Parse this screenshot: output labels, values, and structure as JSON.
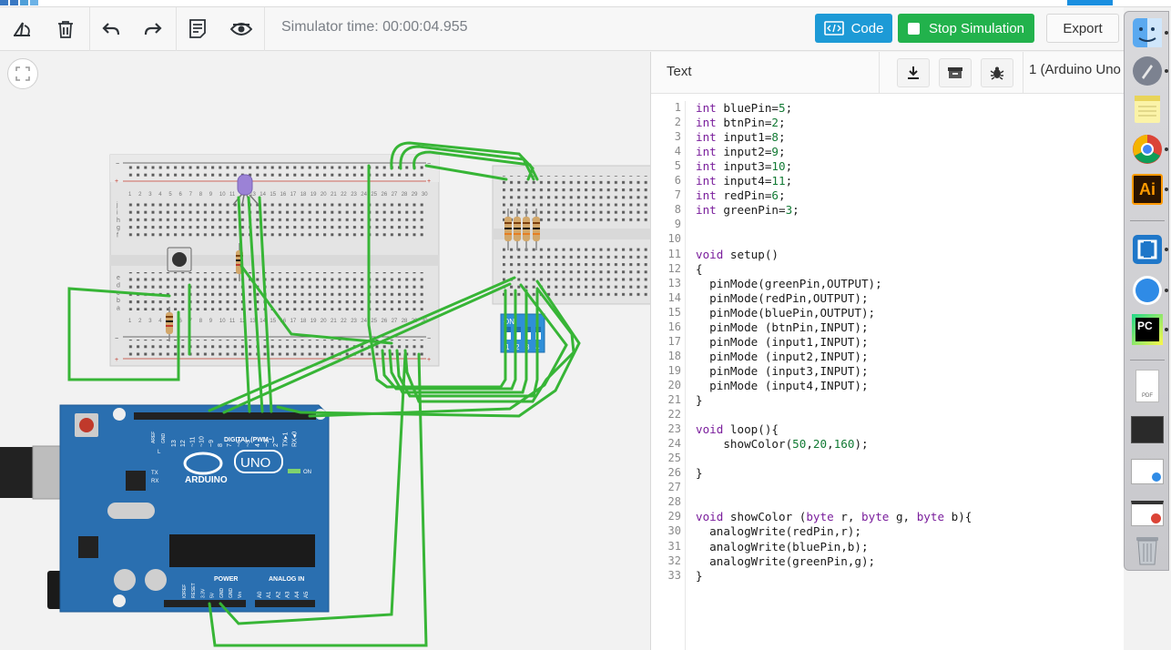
{
  "toolbar": {
    "rotate_icon": "rotate-icon",
    "delete_icon": "trash-icon",
    "undo_icon": "undo-icon",
    "redo_icon": "redo-icon",
    "notes_icon": "notes-icon",
    "visibility_icon": "eye-icon",
    "sim_time": "Simulator time: 00:00:04.955",
    "code_label": "Code",
    "stop_label": "Stop Simulation",
    "export_label": "Export",
    "colors": {
      "code_btn": "#1d9ad6",
      "stop_btn": "#22b24c"
    }
  },
  "code_panel": {
    "mode": "Text",
    "device": "1 (Arduino Uno",
    "download_icon": "download-icon",
    "library_icon": "library-icon",
    "debug_icon": "bug-icon",
    "lines": [
      {
        "n": "1",
        "code": "int bluePin=5;"
      },
      {
        "n": "2",
        "code": "int btnPin=2;"
      },
      {
        "n": "3",
        "code": "int input1=8;"
      },
      {
        "n": "4",
        "code": "int input2=9;"
      },
      {
        "n": "5",
        "code": "int input3=10;"
      },
      {
        "n": "6",
        "code": "int input4=11;"
      },
      {
        "n": "7",
        "code": "int redPin=6;"
      },
      {
        "n": "8",
        "code": "int greenPin=3;"
      },
      {
        "n": "9",
        "code": ""
      },
      {
        "n": "10",
        "code": ""
      },
      {
        "n": "11",
        "code": "void setup()"
      },
      {
        "n": "12",
        "code": "{"
      },
      {
        "n": "13",
        "code": "  pinMode(greenPin,OUTPUT);"
      },
      {
        "n": "14",
        "code": "  pinMode(redPin,OUTPUT);"
      },
      {
        "n": "15",
        "code": "  pinMode(bluePin,OUTPUT);"
      },
      {
        "n": "16",
        "code": "  pinMode (btnPin,INPUT);"
      },
      {
        "n": "17",
        "code": "  pinMode (input1,INPUT);"
      },
      {
        "n": "18",
        "code": "  pinMode (input2,INPUT);"
      },
      {
        "n": "19",
        "code": "  pinMode (input3,INPUT);"
      },
      {
        "n": "20",
        "code": "  pinMode (input4,INPUT);"
      },
      {
        "n": "21",
        "code": "}"
      },
      {
        "n": "22",
        "code": ""
      },
      {
        "n": "23",
        "code": "void loop(){"
      },
      {
        "n": "24",
        "code": "    showColor(50,20,160);"
      },
      {
        "n": "25",
        "code": ""
      },
      {
        "n": "26",
        "code": "}"
      },
      {
        "n": "27",
        "code": ""
      },
      {
        "n": "28",
        "code": ""
      },
      {
        "n": "29",
        "code": "void showColor (byte r, byte g, byte b){"
      },
      {
        "n": "30",
        "code": "  analogWrite(redPin,r);"
      },
      {
        "n": "31",
        "code": "  analogWrite(bluePin,b);"
      },
      {
        "n": "32",
        "code": "  analogWrite(greenPin,g);"
      },
      {
        "n": "33",
        "code": "}"
      }
    ]
  },
  "canvas": {
    "fit_icon": "fit-to-view-icon",
    "arduino": {
      "brand": "ARDUINO",
      "model": "UNO",
      "digital_label": "DIGITAL (PWM~)",
      "power_label": "POWER",
      "analog_label": "ANALOG IN",
      "on_label": "ON",
      "tx_label": "TX",
      "rx_label": "RX",
      "l_label": "L",
      "aref_label": "AREF",
      "gnd_label": "GND",
      "digital_pins": [
        "13",
        "12",
        "~11",
        "~10",
        "~9",
        "8",
        "7",
        "~6",
        "~5",
        "4",
        "~3",
        "2",
        "TX▸1",
        "RX◂0"
      ],
      "power_pins": [
        "IOREF",
        "RESET",
        "3.3V",
        "5V",
        "GND",
        "GND",
        "Vin"
      ],
      "analog_pins": [
        "A0",
        "A1",
        "A2",
        "A3",
        "A4",
        "A5"
      ]
    },
    "dip_switch_label": "ON",
    "dip_switch_numbers": [
      "1",
      "2",
      "3",
      "4"
    ],
    "breadboard_cols": [
      "1",
      "2",
      "3",
      "4",
      "5",
      "6",
      "7",
      "8",
      "9",
      "10",
      "11",
      "12",
      "13",
      "14",
      "15",
      "16",
      "17",
      "18",
      "19",
      "20",
      "21",
      "22",
      "23",
      "24",
      "25",
      "26",
      "27",
      "28",
      "29",
      "30"
    ],
    "breadboard_rows_top": [
      "j",
      "i",
      "h",
      "g",
      "f"
    ],
    "breadboard_rows_bottom": [
      "e",
      "d",
      "c",
      "b",
      "a"
    ],
    "rail_plus": "+",
    "rail_minus": "−",
    "wire_color": "#37b536"
  },
  "dock": {
    "items": [
      "finder-icon",
      "launchpad-icon",
      "notes-app-icon",
      "chrome-icon",
      "illustrator-icon",
      "brackets-icon",
      "safari-icon",
      "pycharm-icon",
      "pdf-file-icon",
      "screenshot-icon",
      "preview-icon",
      "window-icon",
      "trash-can-icon"
    ],
    "illustrator_text": "Ai",
    "pycharm_text": "PC",
    "pdf_text": "PDF"
  }
}
